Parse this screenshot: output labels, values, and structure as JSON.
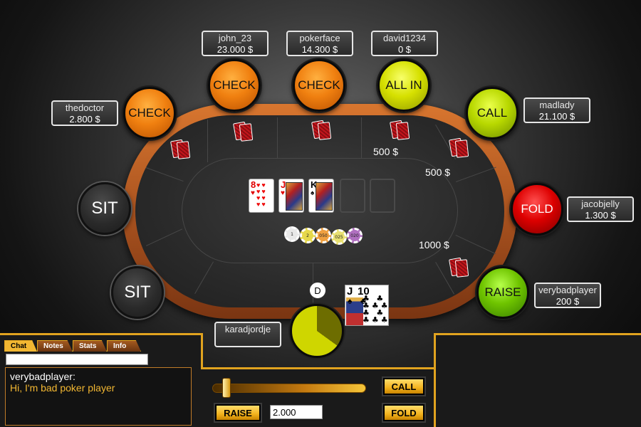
{
  "seats": [
    {
      "id": "thedoctor",
      "action": "CHECK",
      "name": "thedoctor",
      "chips": "2.800 $"
    },
    {
      "id": "john_23",
      "action": "CHECK",
      "name": "john_23",
      "chips": "23.000 $"
    },
    {
      "id": "pokerface",
      "action": "CHECK",
      "name": "pokerface",
      "chips": "14.300 $"
    },
    {
      "id": "david1234",
      "action": "ALL IN",
      "name": "david1234",
      "chips": "0 $"
    },
    {
      "id": "madlady",
      "action": "CALL",
      "name": "madlady",
      "chips": "21.100 $"
    },
    {
      "id": "jacobjelly",
      "action": "FOLD",
      "name": "jacobjelly",
      "chips": "1.300 $"
    },
    {
      "id": "verybadplayer",
      "action": "RAISE",
      "name": "verybadplayer",
      "chips": "200 $"
    }
  ],
  "empty_seats": [
    "SIT",
    "SIT"
  ],
  "hero": {
    "name": "karadjordje"
  },
  "bets": [
    "500 $",
    "500 $",
    "1000 $"
  ],
  "dealer_button": "D",
  "community_cards": [
    {
      "rank": "8",
      "suit": "♥",
      "color": "#e00000"
    },
    {
      "rank": "J",
      "suit": "♥",
      "color": "#e00000"
    },
    {
      "rank": "K",
      "suit": "♠",
      "color": "#000000"
    }
  ],
  "hero_cards": [
    {
      "rank": "J",
      "suit": "♠"
    },
    {
      "rank": "10",
      "suit": "♣"
    }
  ],
  "pot_chips": [
    {
      "label": "1",
      "color": "#e8e8e8"
    },
    {
      "label": "2",
      "color": "#e6d84a"
    },
    {
      "label": "050",
      "color": "#f0a040"
    },
    {
      "label": "025",
      "color": "#e8e070"
    },
    {
      "label": "020",
      "color": "#b070c0"
    }
  ],
  "timer": {
    "fraction_elapsed": 0.35
  },
  "chat": {
    "tabs": [
      "Chat",
      "Notes",
      "Stats",
      "Info"
    ],
    "active_tab": "Chat",
    "input_value": "",
    "author": "verybadplayer:",
    "message": "Hi, I'm bad poker player"
  },
  "controls": {
    "call_label": "CALL",
    "fold_label": "FOLD",
    "raise_label": "RAISE",
    "raise_amount": "2.000",
    "slider_fraction": 0.05
  },
  "colors": {
    "accent": "#f2b732",
    "rail": "#c0622a",
    "felt": "#2e2e2e"
  }
}
